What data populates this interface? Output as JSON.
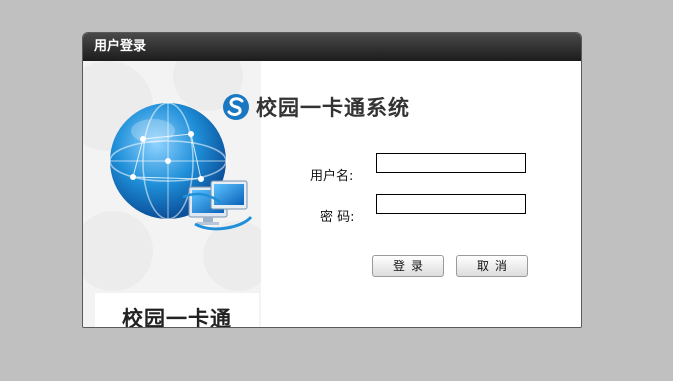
{
  "dialog": {
    "title": "用户登录"
  },
  "left_panel": {
    "brand_text": "校园一卡通"
  },
  "header": {
    "system_title": "校园一卡通系统"
  },
  "form": {
    "username_label": "用户名:",
    "username_value": "",
    "password_label": "密 码:",
    "password_value": ""
  },
  "buttons": {
    "login_label": "登录",
    "cancel_label": "取消"
  },
  "colors": {
    "background": "#c0c0c0",
    "titlebar": "#2a2a2a",
    "globe_blue": "#1f8fd8",
    "logo_blue": "#1a78c2"
  }
}
